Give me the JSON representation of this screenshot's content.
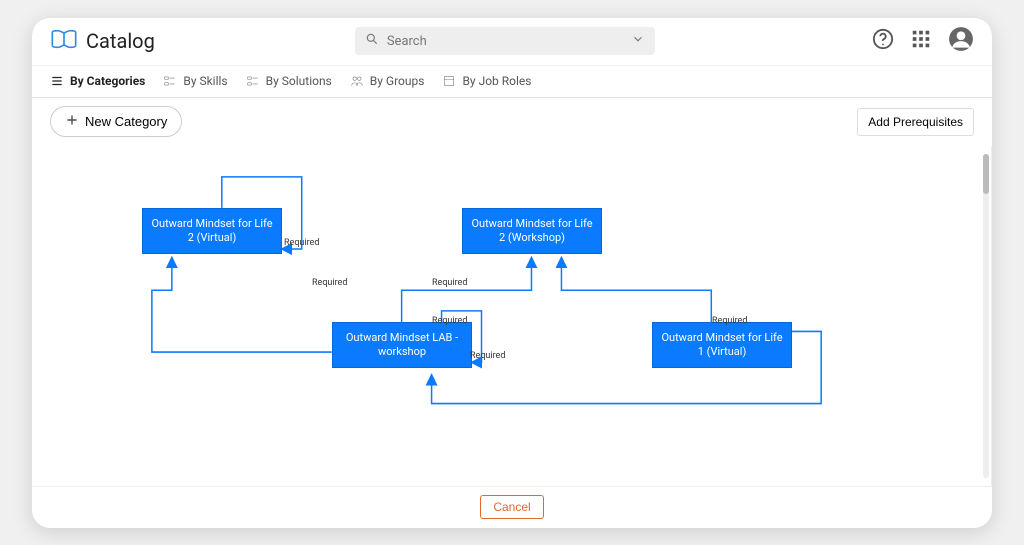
{
  "header": {
    "title": "Catalog",
    "search_placeholder": "Search"
  },
  "tabs": [
    {
      "label": "By Categories",
      "active": true
    },
    {
      "label": "By Skills",
      "active": false
    },
    {
      "label": "By Solutions",
      "active": false
    },
    {
      "label": "By Groups",
      "active": false
    },
    {
      "label": "By Job Roles",
      "active": false
    }
  ],
  "toolbar": {
    "new_category_label": "New Category",
    "add_prerequisites_label": "Add Prerequisites"
  },
  "diagram": {
    "nodes": [
      {
        "id": "n1",
        "title": "Outward Mindset for Life 2 (Virtual)"
      },
      {
        "id": "n2",
        "title": "Outward Mindset for Life 2 (Workshop)"
      },
      {
        "id": "n3",
        "title": "Outward Mindset LAB - workshop"
      },
      {
        "id": "n4",
        "title": "Outward Mindset for Life 1 (Virtual)"
      }
    ],
    "edges": [
      {
        "from": "n1",
        "to": "n1",
        "label": "Required"
      },
      {
        "from": "n3",
        "to": "n1",
        "label": "Required"
      },
      {
        "from": "n3",
        "to": "n2",
        "label": "Required"
      },
      {
        "from": "n4",
        "to": "n3",
        "label": "Required"
      },
      {
        "from": "n4",
        "to": "n2",
        "label": "Required"
      },
      {
        "from": "n3",
        "to": "n3",
        "label": "Required"
      }
    ]
  },
  "footer": {
    "cancel_label": "Cancel"
  },
  "colors": {
    "node_fill": "#0a7aff",
    "node_border": "#0a66d6",
    "accent_orange": "#e06a2b"
  }
}
